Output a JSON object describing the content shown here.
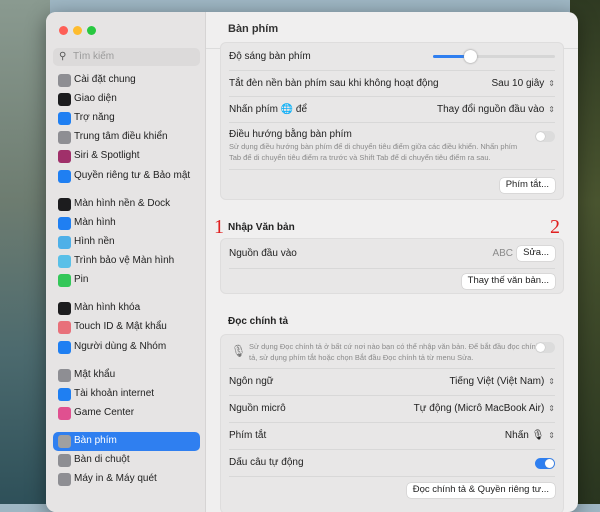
{
  "window": {
    "title": "Bàn phím"
  },
  "sidebar": {
    "search_placeholder": "Tìm kiếm",
    "items": [
      {
        "label": "Cài đặt chung",
        "icon": "gear-icon",
        "color": "#8e8e93"
      },
      {
        "label": "Giao diện",
        "icon": "appearance-icon",
        "color": "#1c1c1e"
      },
      {
        "label": "Trợ năng",
        "icon": "accessibility-icon",
        "color": "#1f7ff2"
      },
      {
        "label": "Trung tâm điều khiển",
        "icon": "control-center-icon",
        "color": "#8e8e93"
      },
      {
        "label": "Siri & Spotlight",
        "icon": "siri-icon",
        "color": "#a0306a"
      },
      {
        "label": "Quyền riêng tư & Bảo mật",
        "icon": "hand-icon",
        "color": "#1f7ff2"
      },
      {
        "label": "Màn hình nền & Dock",
        "icon": "dock-icon",
        "color": "#1c1c1e"
      },
      {
        "label": "Màn hình",
        "icon": "display-icon",
        "color": "#1f7ff2"
      },
      {
        "label": "Hình nền",
        "icon": "wallpaper-icon",
        "color": "#4fb0e8"
      },
      {
        "label": "Trình bảo vệ Màn hình",
        "icon": "screensaver-icon",
        "color": "#5ac0e8"
      },
      {
        "label": "Pin",
        "icon": "battery-icon",
        "color": "#34c759"
      },
      {
        "label": "Màn hình khóa",
        "icon": "lock-icon",
        "color": "#1c1c1e"
      },
      {
        "label": "Touch ID & Mật khẩu",
        "icon": "fingerprint-icon",
        "color": "#e8707a"
      },
      {
        "label": "Người dùng & Nhóm",
        "icon": "users-icon",
        "color": "#1f7ff2"
      },
      {
        "label": "Mật khẩu",
        "icon": "key-icon",
        "color": "#8e8e93"
      },
      {
        "label": "Tài khoản internet",
        "icon": "at-icon",
        "color": "#1f7ff2"
      },
      {
        "label": "Game Center",
        "icon": "game-center-icon",
        "color": "#e05090"
      },
      {
        "label": "Bàn phím",
        "icon": "keyboard-icon",
        "color": "#a0a0a0",
        "selected": true
      },
      {
        "label": "Bàn di chuột",
        "icon": "trackpad-icon",
        "color": "#8e8e93"
      },
      {
        "label": "Máy in & Máy quét",
        "icon": "printer-icon",
        "color": "#8e8e93"
      }
    ]
  },
  "keyboard": {
    "brightness_label": "Độ sáng bàn phím",
    "brightness_value": 0.3,
    "backlight_off_label": "Tắt đèn nền bàn phím sau khi không hoạt động",
    "backlight_off_value": "Sau 10 giây",
    "press_key_label": "Nhấn phím 🌐 để",
    "press_key_value": "Thay đổi nguồn đầu vào",
    "nav_label": "Điều hướng bằng bàn phím",
    "nav_desc": "Sử dụng điều hướng bàn phím để di chuyển tiêu điểm giữa các điều khiển. Nhấn phím Tab để di chuyển tiêu điểm ra trước và Shift Tab để di chuyển tiêu điểm ra sau.",
    "nav_on": false,
    "shortcuts_button": "Phím tắt..."
  },
  "text_input": {
    "heading": "Nhập Văn bản",
    "source_label": "Nguồn đầu vào",
    "source_value": "ABC",
    "edit_button": "Sửa...",
    "replace_button": "Thay thế văn bản..."
  },
  "dictation": {
    "heading": "Đọc chính tả",
    "desc": "Sử dụng Đọc chính tả ở bất cứ nơi nào bạn có thể nhập văn bản. Để bắt đầu đọc chính tả, sử dụng phím tắt hoặc chọn Bắt đầu Đọc chính tả từ menu Sửa.",
    "enabled": false,
    "language_label": "Ngôn ngữ",
    "language_value": "Tiếng Việt (Việt Nam)",
    "mic_label": "Nguồn micrô",
    "mic_value": "Tự động (Micrô MacBook Air)",
    "shortcut_label": "Phím tắt",
    "shortcut_value": "Nhấn 🎙",
    "punct_label": "Dấu câu tự động",
    "punct_on": true,
    "privacy_button": "Đọc chính tả & Quyền riêng tư..."
  },
  "annotations": [
    "1",
    "2"
  ]
}
